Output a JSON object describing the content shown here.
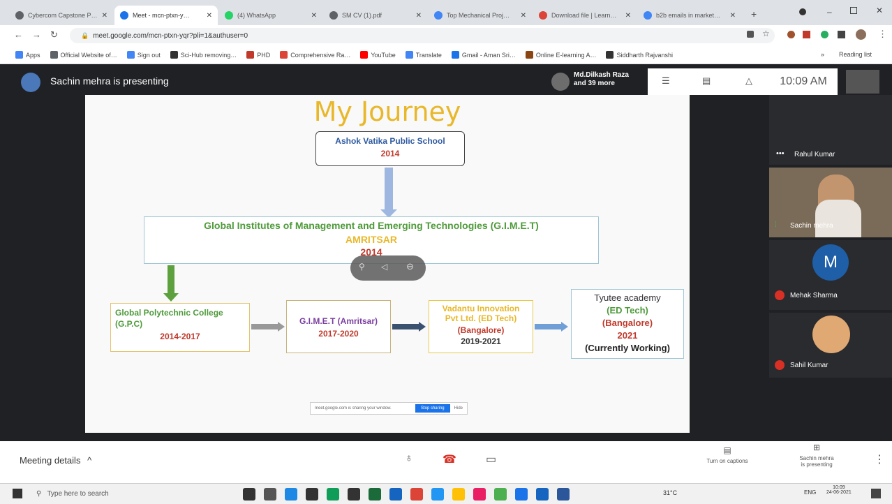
{
  "browser": {
    "tabs": [
      {
        "title": "Cybercom Capstone Pr…",
        "color": "#5f6368"
      },
      {
        "title": "Meet - mcn-ptxn-y…",
        "color": "#1a73e8",
        "active": true
      },
      {
        "title": "(4) WhatsApp",
        "color": "#25d366"
      },
      {
        "title": "SM CV (1).pdf",
        "color": "#5f6368"
      },
      {
        "title": "Top Mechanical Proj…",
        "color": "#4285f4"
      },
      {
        "title": "Download file | Learn…",
        "color": "#db4437"
      },
      {
        "title": "b2b emails in market…",
        "color": "#4285f4"
      }
    ],
    "url": "meet.google.com/mcn-ptxn-yqr?pli=1&authuser=0",
    "bookmarks": [
      "Apps",
      "Official Website of…",
      "Sign out",
      "Sci-Hub removing…",
      "PHD",
      "Comprehensive Ra…",
      "YouTube",
      "Translate",
      "Gmail - Aman Sri…",
      "Online E-learning A…",
      "Siddharth Rajvanshi"
    ],
    "reading_list": "Reading list"
  },
  "meet": {
    "presenter_text": "Sachin mehra is presenting",
    "participants_text_1": "Md.Dilkash Raza",
    "participants_text_2": "and 39 more",
    "clock": "10:09 AM",
    "tiles": [
      {
        "name": "Rahul Kumar"
      },
      {
        "name": "Sachin mehra"
      },
      {
        "name": "Mehak Sharma",
        "initial": "M"
      },
      {
        "name": "Sahil Kumar"
      }
    ],
    "meeting_details": "Meeting details",
    "captions_label": "Turn on captions",
    "presenting_label_1": "Sachin mehra",
    "presenting_label_2": "is presenting",
    "share_bar_text": "meet.google.com is sharing your window.",
    "stop_sharing": "Stop sharing",
    "hide": "Hide"
  },
  "slide": {
    "title": "My Journey",
    "school_name": "Ashok Vatika Public School",
    "school_year": "2014",
    "gimet_name": "Global Institutes of Management and Emerging Technologies (G.I.M.E.T)",
    "gimet_city": "AMRITSAR",
    "gimet_year": "2014",
    "gpc_name": "Global Polytechnic College",
    "gpc_abbr": "(G.P.C)",
    "gpc_years": "2014-2017",
    "gimet2_name": "G.I.M.E.T (Amritsar)",
    "gimet2_years": "2017-2020",
    "vedantu_name_1": "Vadantu Innovation",
    "vedantu_name_2": "Pvt Ltd. (ED Tech)",
    "vedantu_city": "(Bangalore)",
    "vedantu_years": "2019-2021",
    "tyutee_name": "Tyutee academy",
    "tyutee_type": "(ED Tech)",
    "tyutee_city": "(Bangalore)",
    "tyutee_year": "2021",
    "tyutee_status": "(Currently Working)"
  },
  "taskbar": {
    "search_placeholder": "Type here to search",
    "weather": "31°C",
    "lang": "ENG",
    "time": "10:09",
    "date": "24-06-2021"
  }
}
